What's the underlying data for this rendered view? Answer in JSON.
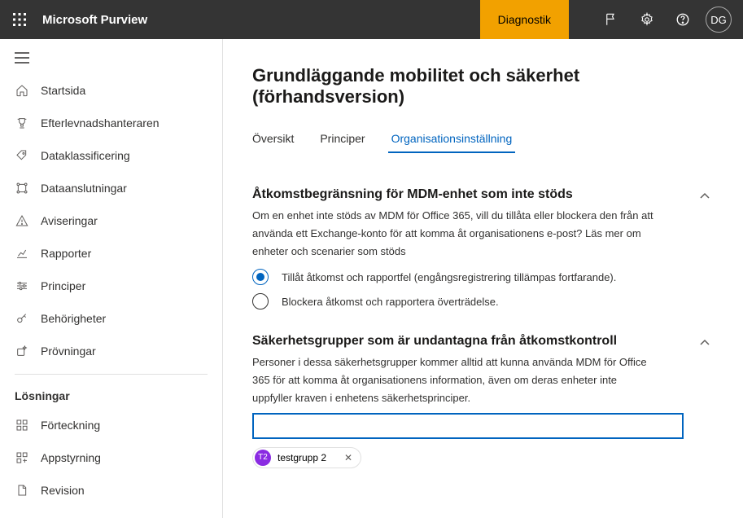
{
  "header": {
    "brand": "Microsoft Purview",
    "diagnostic": "Diagnostik",
    "avatar_initials": "DG"
  },
  "sidebar": {
    "items": [
      {
        "label": "Startsida"
      },
      {
        "label": "Efterlevnadshanteraren"
      },
      {
        "label": "Dataklassificering"
      },
      {
        "label": "Dataanslutningar"
      },
      {
        "label": "Aviseringar"
      },
      {
        "label": "Rapporter"
      },
      {
        "label": "Principer"
      },
      {
        "label": "Behörigheter"
      },
      {
        "label": "Prövningar"
      }
    ],
    "solutions_heading": "Lösningar",
    "solutions": [
      {
        "label": "Förteckning"
      },
      {
        "label": "Appstyrning"
      },
      {
        "label": "Revision"
      }
    ]
  },
  "main": {
    "title": "Grundläggande mobilitet och säkerhet (förhandsversion)",
    "tabs": [
      {
        "label": "Översikt"
      },
      {
        "label": "Principer"
      },
      {
        "label": "Organisationsinställning"
      }
    ],
    "section1": {
      "title": "Åtkomstbegränsning för MDM-enhet som inte stöds",
      "desc": "Om en enhet inte stöds av MDM för Office 365, vill du tillåta eller blockera den från att använda ett Exchange-konto för att komma åt organisationens e-post? Läs mer om enheter och scenarier som stöds",
      "option_allow": "Tillåt åtkomst och rapportfel (engångsregistrering tillämpas fortfarande).",
      "option_block": "Blockera åtkomst och rapportera överträdelse."
    },
    "section2": {
      "title": "Säkerhetsgrupper som är undantagna från åtkomstkontroll",
      "desc": "Personer i dessa säkerhetsgrupper kommer alltid att kunna använda MDM för Office 365 för att komma åt organisationens information, även om deras enheter inte uppfyller kraven i enhetens säkerhetsprinciper.",
      "chip_initials": "T2",
      "chip_label": "testgrupp 2"
    }
  }
}
